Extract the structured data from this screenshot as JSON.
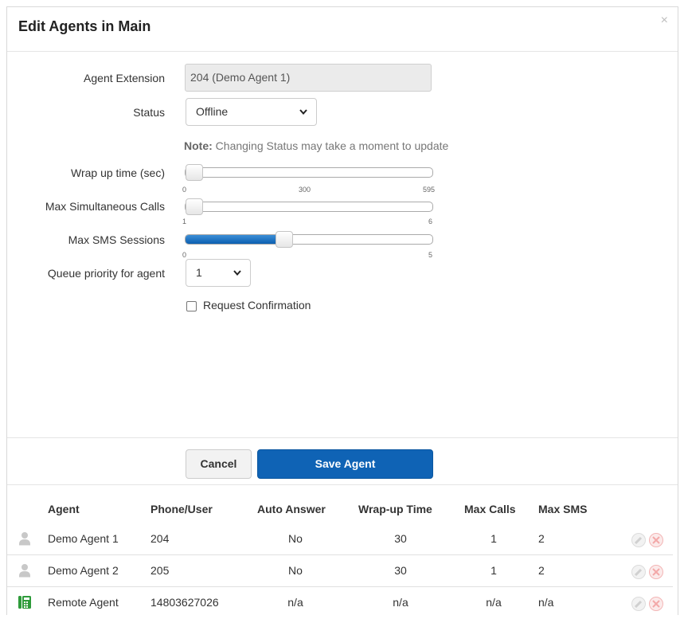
{
  "dialog": {
    "title": "Edit Agents in Main",
    "close_glyph": "×"
  },
  "form": {
    "extension_label": "Agent Extension",
    "extension_value": "204 (Demo Agent 1)",
    "status_label": "Status",
    "status_value": "Offline",
    "note_bold": "Note:",
    "note_text": " Changing Status may take a moment to update",
    "wrapup_label": "Wrap up time (sec)",
    "wrapup_ticks": [
      "0",
      "300",
      "595"
    ],
    "wrapup_value": 0,
    "max_calls_label": "Max Simultaneous Calls",
    "max_calls_ticks": [
      "1",
      "6"
    ],
    "max_calls_value": 1,
    "max_sms_label": "Max SMS Sessions",
    "max_sms_ticks": [
      "0",
      "5"
    ],
    "max_sms_value": 2,
    "queue_priority_label": "Queue priority for agent",
    "queue_priority_value": "1",
    "request_confirmation_label": "Request Confirmation",
    "request_confirmation_checked": false
  },
  "buttons": {
    "cancel": "Cancel",
    "save": "Save Agent"
  },
  "table": {
    "headers": [
      "Agent",
      "Phone/User",
      "Auto Answer",
      "Wrap-up Time",
      "Max Calls",
      "Max SMS"
    ],
    "rows": [
      {
        "icon": "user-icon",
        "agent": "Demo Agent 1",
        "phone": "204",
        "auto_answer": "No",
        "wrapup": "30",
        "max_calls": "1",
        "max_sms": "2"
      },
      {
        "icon": "user-icon",
        "agent": "Demo Agent 2",
        "phone": "205",
        "auto_answer": "No",
        "wrapup": "30",
        "max_calls": "1",
        "max_sms": "2"
      },
      {
        "icon": "phone-icon",
        "agent": "Remote Agent",
        "phone": "14803627026",
        "auto_answer": "n/a",
        "wrapup": "n/a",
        "max_calls": "n/a",
        "max_sms": "n/a"
      }
    ]
  },
  "colors": {
    "primary": "#0f63b5",
    "remote_icon": "#2e9b3a"
  }
}
